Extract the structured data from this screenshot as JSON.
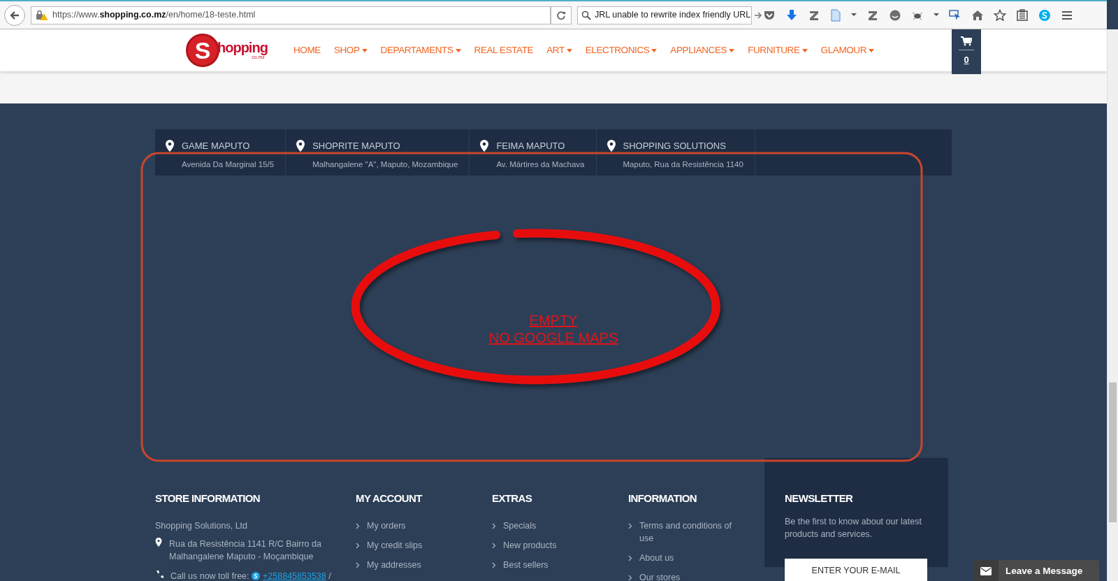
{
  "browser": {
    "url": "https://www.**shopping.co.mz**/en/home/18-teste.html",
    "search_value": "JRL unable to rewrite index friendly URL"
  },
  "header": {
    "logo": {
      "letter": "S",
      "text": "hopping",
      "sub": "co.mz"
    },
    "menu": [
      {
        "label": "HOME",
        "dropdown": false
      },
      {
        "label": "SHOP",
        "dropdown": true
      },
      {
        "label": "DEPARTAMENTS",
        "dropdown": true
      },
      {
        "label": "REAL ESTATE",
        "dropdown": false
      },
      {
        "label": "ART",
        "dropdown": true
      },
      {
        "label": "ELECTRONICS",
        "dropdown": true
      },
      {
        "label": "APPLIANCES",
        "dropdown": true
      },
      {
        "label": "FURNITURE",
        "dropdown": true
      },
      {
        "label": "GLAMOUR",
        "dropdown": true
      }
    ],
    "cart_count": "0"
  },
  "stores": [
    {
      "name": "GAME MAPUTO",
      "address": "Avenida Da Marginal 15/5"
    },
    {
      "name": "SHOPRITE MAPUTO",
      "address": "Malhangalene \"A\", Maputo, Mozambique"
    },
    {
      "name": "FEIMA MAPUTO",
      "address": "Av. Mártires da Machava"
    },
    {
      "name": "SHOPPING SOLUTIONS",
      "address": "Maputo, Rua da Resistência 1140"
    }
  ],
  "map_placeholder": [
    "EMPTY",
    "NO GOOGLE MAPS"
  ],
  "footer": {
    "store_information": {
      "title": "STORE INFORMATION",
      "company": "Shopping Solutions, Ltd",
      "address": "Rua da Resistência 1141 R/C Bairro da Malhangalene Maputo - Moçambique",
      "phone_label": "Call us now toll free:",
      "phone": "+258845853538",
      "phone_after": "/"
    },
    "link_columns": [
      {
        "title": "MY ACCOUNT",
        "links": [
          "My orders",
          "My credit slips",
          "My addresses"
        ]
      },
      {
        "title": "EXTRAS",
        "links": [
          "Specials",
          "New products",
          "Best sellers"
        ]
      },
      {
        "title": "INFORMATION",
        "links": [
          "Terms and conditions of use",
          "About us",
          "Our stores"
        ]
      }
    ],
    "newsletter": {
      "title": "NEWSLETTER",
      "text": "Be the first to know about our latest products and services.",
      "placeholder": "ENTER YOUR E-MAIL"
    }
  },
  "chat": {
    "label": "Leave a Message"
  }
}
